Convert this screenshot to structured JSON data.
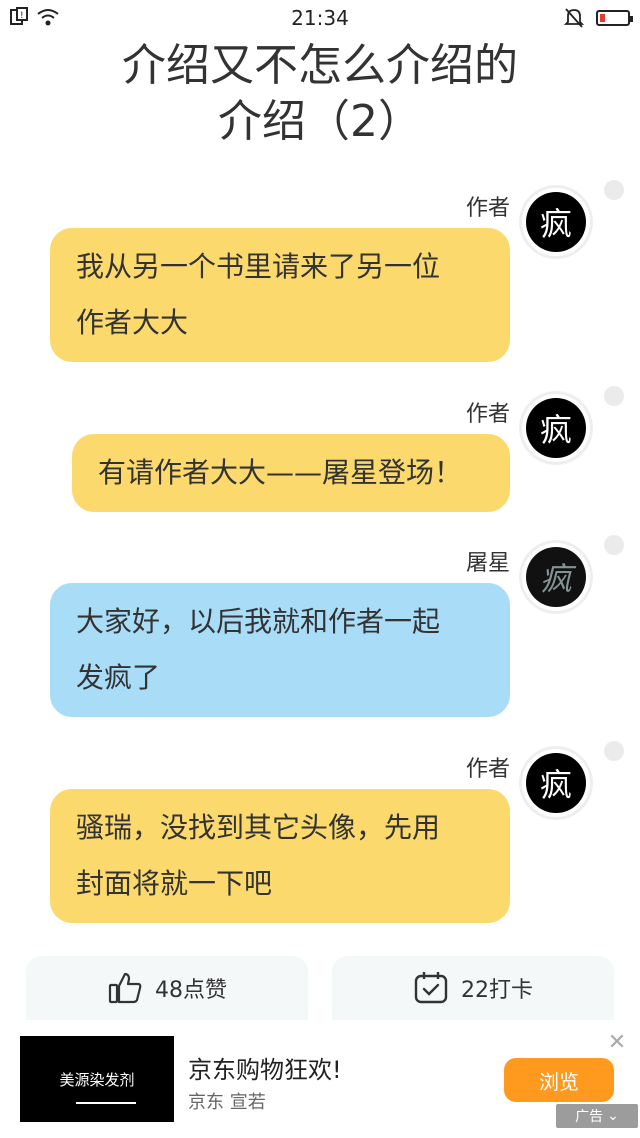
{
  "status": {
    "time": "21:34"
  },
  "title": {
    "line1": "介绍又不怎么介绍的",
    "line2": "介绍（2）"
  },
  "messages": [
    {
      "author": "作者",
      "avatar_char": "疯",
      "lines": [
        "我从另一个书里请来了另一位",
        "作者大大"
      ],
      "color": "yellow"
    },
    {
      "author": "作者",
      "avatar_char": "疯",
      "lines": [
        "有请作者大大——屠星登场！"
      ],
      "color": "yellow"
    },
    {
      "author": "屠星",
      "avatar_char": "疯",
      "lines": [
        "大家好，以后我就和作者一起",
        "发疯了"
      ],
      "color": "blue"
    },
    {
      "author": "作者",
      "avatar_char": "疯",
      "lines": [
        "骚瑞，没找到其它头像，先用",
        "封面将就一下吧"
      ],
      "color": "yellow"
    }
  ],
  "actions": {
    "like_label": "48点赞",
    "checkin_label": "22打卡"
  },
  "ad": {
    "thumb_text": "美源染发剂",
    "title": "京东购物狂欢!",
    "subtitle": "京东 宣若",
    "button_label": "浏览",
    "tag_label": "广告"
  },
  "colors": {
    "yellow_bubble": "#fbd96d",
    "blue_bubble": "#a9dcf6",
    "ad_button": "#ff9a1f"
  }
}
